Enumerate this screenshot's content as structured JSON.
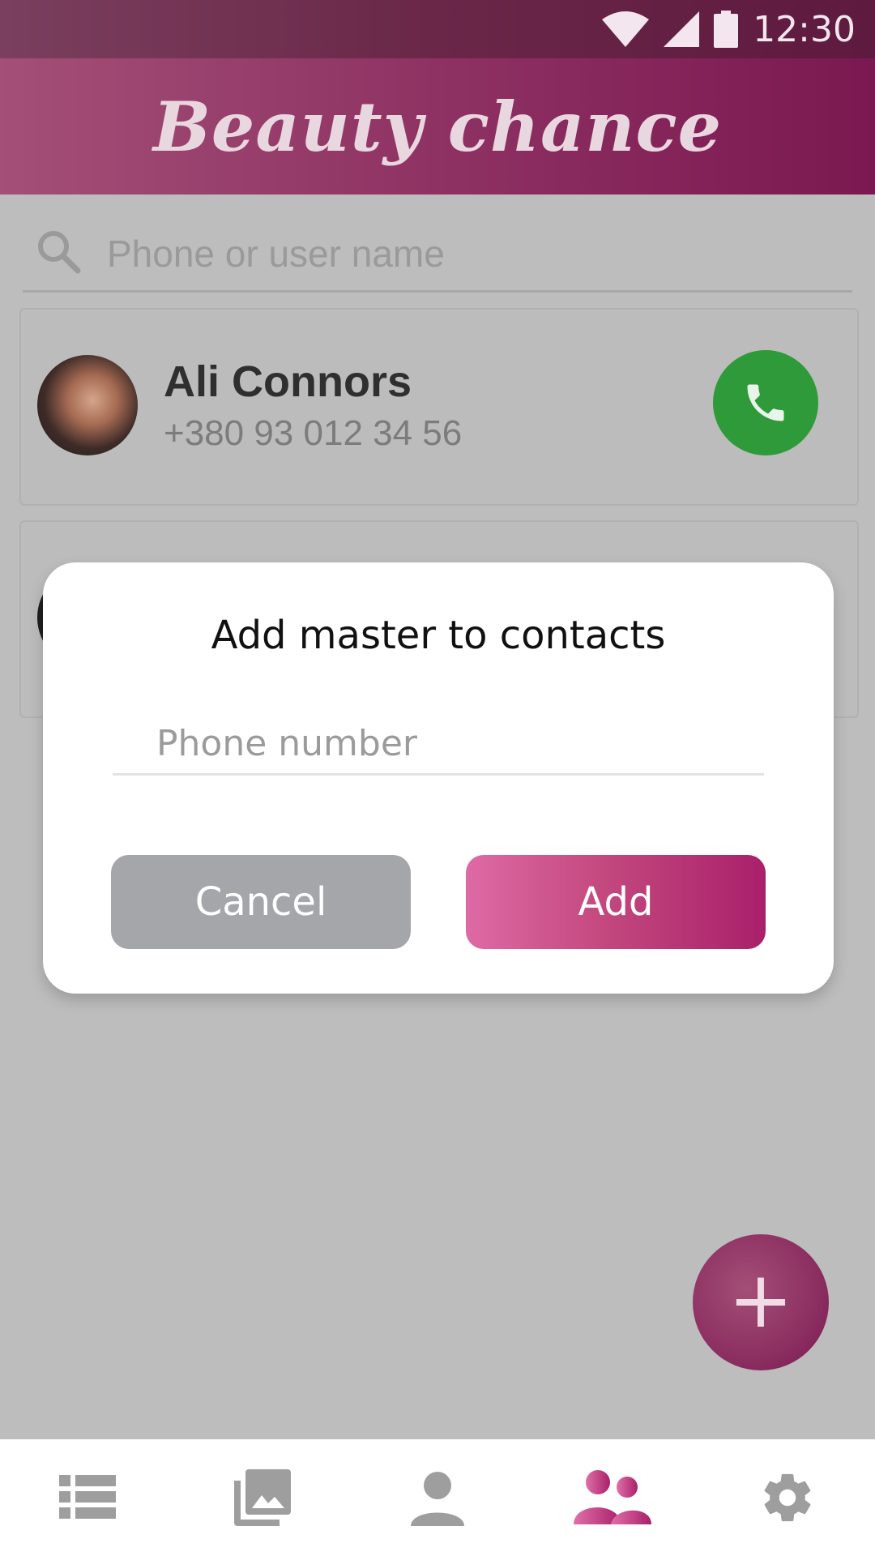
{
  "status_bar": {
    "time": "12:30"
  },
  "app": {
    "title": "Beauty chance"
  },
  "search": {
    "placeholder": "Phone or user name"
  },
  "contacts": [
    {
      "name": "Ali Connors",
      "phone": "+380 93 012 34 56"
    }
  ],
  "dialog": {
    "title": "Add master to contacts",
    "phone_placeholder": "Phone number",
    "cancel_label": "Cancel",
    "add_label": "Add"
  },
  "fab": {
    "label": "+"
  },
  "bottom_nav": {
    "items": [
      {
        "icon": "list-icon"
      },
      {
        "icon": "gallery-icon"
      },
      {
        "icon": "person-icon"
      },
      {
        "icon": "people-icon",
        "active": true
      },
      {
        "icon": "settings-icon"
      }
    ]
  },
  "colors": {
    "accent": "#a9206a",
    "call": "#2f9a39",
    "nav_inactive": "#9e9e9e",
    "nav_active": "#b02a73"
  }
}
